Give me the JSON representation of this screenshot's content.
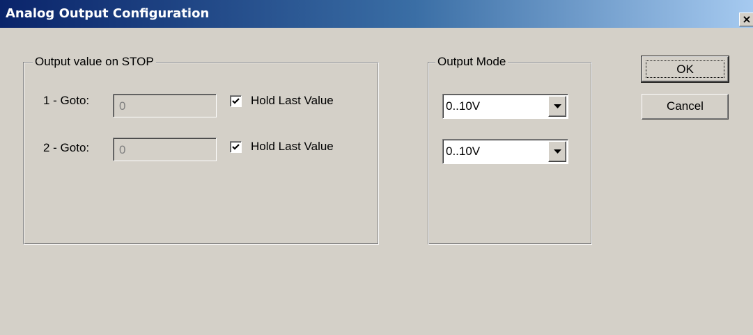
{
  "window": {
    "title": "Analog Output Configuration",
    "close_glyph": "×"
  },
  "stop_group": {
    "legend": "Output value on STOP",
    "rows": [
      {
        "label": "1 - Goto:",
        "value": "0",
        "enabled": false,
        "hold_label": "Hold Last Value",
        "hold_checked": true
      },
      {
        "label": "2 - Goto:",
        "value": "0",
        "enabled": false,
        "hold_label": "Hold Last Value",
        "hold_checked": true
      }
    ]
  },
  "mode_group": {
    "legend": "Output Mode",
    "selects": [
      {
        "value": "0..10V"
      },
      {
        "value": "0..10V"
      }
    ]
  },
  "buttons": {
    "ok_label": "OK",
    "cancel_label": "Cancel"
  },
  "icons": {
    "close": "close-icon",
    "check": "checkmark-icon",
    "dropdown": "chevron-down-icon"
  },
  "colors": {
    "titlebar_start": "#0a246a",
    "titlebar_end": "#a6caf0",
    "face": "#d4d0c8"
  }
}
